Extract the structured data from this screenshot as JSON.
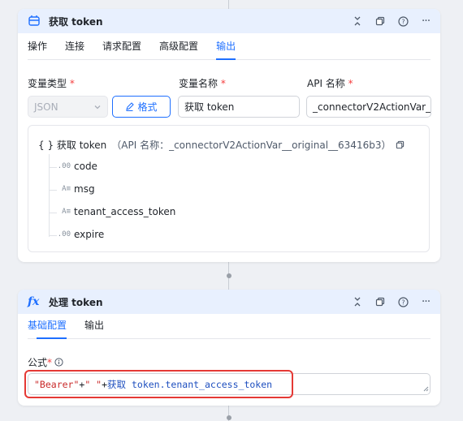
{
  "node1": {
    "title": "获取 token",
    "tabs": [
      "操作",
      "连接",
      "请求配置",
      "高级配置",
      "输出"
    ],
    "active_tab": "输出",
    "var_type_label": "变量类型",
    "var_type_value": "JSON",
    "format_button": "格式",
    "var_name_label": "变量名称",
    "var_name_value": "获取 token",
    "api_name_label": "API 名称",
    "api_name_value": "_connectorV2ActionVar_",
    "tree_root": "{ } 获取 token",
    "tree_root_api": "（API 名称：_connectorV2ActionVar__original__63416b3）",
    "fields": [
      {
        "type": ".00",
        "name": "code"
      },
      {
        "type": "A≡",
        "name": "msg"
      },
      {
        "type": "A≡",
        "name": "tenant_access_token"
      },
      {
        "type": ".00",
        "name": "expire"
      }
    ]
  },
  "node2": {
    "title": "处理 token",
    "icon_text": "fx",
    "tabs": [
      "基础配置",
      "输出"
    ],
    "active_tab": "基础配置",
    "formula_label": "公式",
    "formula": {
      "str1": "\"Bearer\"",
      "plus1": "+",
      "str2": "\" \"",
      "plus2": "+",
      "ref": "获取 token.tenant_access_token"
    }
  },
  "colors": {
    "accent": "#1e6fff",
    "highlight": "#e53935",
    "header_bg": "#e8f0fe"
  }
}
